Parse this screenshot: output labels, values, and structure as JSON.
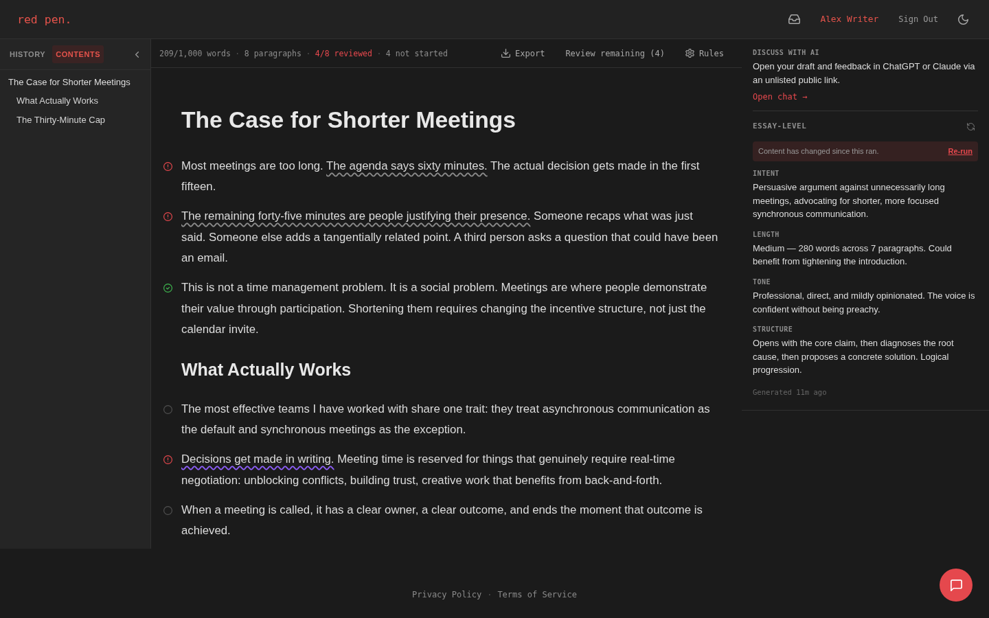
{
  "header": {
    "logo": "red pen.",
    "user": "Alex Writer",
    "sign_out": "Sign Out"
  },
  "sidebar": {
    "tabs": [
      {
        "label": "HISTORY",
        "selected": false
      },
      {
        "label": "CONTENTS",
        "selected": true
      }
    ],
    "outline": [
      {
        "label": "The Case for Shorter Meetings",
        "children": [
          {
            "label": "What Actually Works"
          },
          {
            "label": "The Thirty-Minute Cap"
          }
        ]
      }
    ]
  },
  "toolbar": {
    "separator": "·",
    "stats": [
      {
        "text": "209/1,000 words",
        "highlighted": false
      },
      {
        "text": "8 paragraphs",
        "highlighted": false
      },
      {
        "text": "4/8 reviewed",
        "highlighted": true
      },
      {
        "text": "4 not started",
        "highlighted": false
      }
    ],
    "actions": [
      {
        "kind": "export",
        "label": "Export"
      },
      {
        "kind": "review",
        "label": "Review remaining (4)"
      },
      {
        "kind": "rules",
        "label": "Rules"
      }
    ]
  },
  "document": {
    "blocks": [
      {
        "kind": "title",
        "text": "The Case for Shorter Meetings"
      },
      {
        "kind": "paragraph",
        "reviewed": false,
        "flagged": true,
        "segments": [
          {
            "text": "Most meetings are too long. "
          },
          {
            "text": "The agenda says sixty minutes.",
            "color": "#8a8a8a"
          },
          {
            "text": " The actual decision gets made in the first fifteen."
          }
        ]
      },
      {
        "kind": "paragraph",
        "reviewed": false,
        "flagged": true,
        "segments": [
          {
            "text": "The remaining forty-five minutes are people justifying their presence.",
            "color": "#8a8a8a"
          },
          {
            "text": " Someone recaps what was just said. Someone else adds a tangentially related point. A third person asks a question that could have been an email."
          }
        ]
      },
      {
        "kind": "paragraph",
        "reviewed": true,
        "flagged": false,
        "segments": [
          {
            "text": "This is not a time management problem. It is a social problem. Meetings are where people demonstrate their value through participation. Shortening them requires changing the incentive structure, not just the calendar invite."
          }
        ]
      },
      {
        "kind": "heading",
        "text": "What Actually Works"
      },
      {
        "kind": "paragraph",
        "reviewed": false,
        "flagged": false,
        "segments": [
          {
            "text": "The most effective teams I have worked with share one trait: they treat asynchronous communication as the default and synchronous meetings as the exception."
          }
        ]
      },
      {
        "kind": "paragraph",
        "reviewed": false,
        "flagged": true,
        "segments": [
          {
            "text": "Decisions get made in writing.",
            "color": "#8b5cf6"
          },
          {
            "text": " Meeting time is reserved for things that genuinely require real-time negotiation: unblocking conflicts, building trust, creative work that benefits from back-and-forth."
          }
        ]
      },
      {
        "kind": "paragraph",
        "reviewed": false,
        "flagged": false,
        "segments": [
          {
            "text": "When a meeting is called, it has a clear owner, a clear outcome, and ends the moment that outcome is achieved."
          }
        ]
      }
    ]
  },
  "discuss": {
    "heading": "DISCUSS WITH AI",
    "text": "Open your draft and feedback in ChatGPT or Claude via an unlisted public link.",
    "link": "Open chat →"
  },
  "essay_level": {
    "heading": "ESSAY-LEVEL",
    "notice": {
      "text": "Content has changed since this ran.",
      "action": "Re-run"
    },
    "sections": [
      {
        "label": "INTENT",
        "text": "Persuasive argument against unnecessarily long meetings, advocating for shorter, more focused synchronous communication."
      },
      {
        "label": "LENGTH",
        "text": "Medium — 280 words across 7 paragraphs. Could benefit from tightening the introduction."
      },
      {
        "label": "TONE",
        "text": "Professional, direct, and mildly opinionated. The voice is confident without being preachy."
      },
      {
        "label": "STRUCTURE",
        "text": "Opens with the core claim, then diagnoses the root cause, then proposes a concrete solution. Logical progression."
      }
    ],
    "generated": "Generated 11m ago"
  },
  "footer": {
    "separator": "·",
    "links": [
      "Privacy Policy",
      "Terms of Service"
    ]
  }
}
